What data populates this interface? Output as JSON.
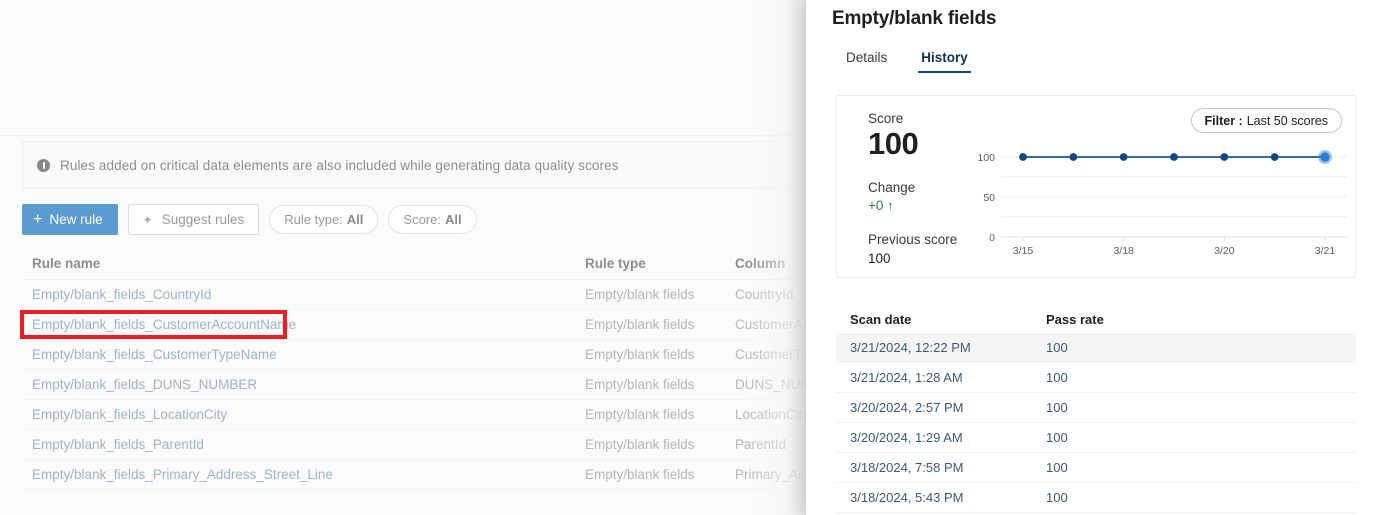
{
  "background_panel": {
    "info_banner": {
      "icon": "info-icon",
      "text": "Rules added on critical data elements are also included while generating data quality scores"
    },
    "toolbar": {
      "new_rule_label": "New rule",
      "new_rule_icon": "plus-icon",
      "suggest_rules_label": "Suggest rules",
      "suggest_rules_icon": "sparkle-icon",
      "rule_type_filter_prefix": "Rule type:",
      "rule_type_filter_value": "All",
      "score_filter_prefix": "Score:",
      "score_filter_value": "All"
    },
    "rules_table": {
      "columns": [
        "Rule name",
        "Rule type",
        "Column"
      ],
      "rows": [
        {
          "name": "Empty/blank_fields_CountryId",
          "type": "Empty/blank fields",
          "column": "CountryId",
          "highlighted": false
        },
        {
          "name": "Empty/blank_fields_CustomerAccountName",
          "type": "Empty/blank fields",
          "column": "CustomerAcc",
          "highlighted": true
        },
        {
          "name": "Empty/blank_fields_CustomerTypeName",
          "type": "Empty/blank fields",
          "column": "CustomerTyp",
          "highlighted": false
        },
        {
          "name": "Empty/blank_fields_DUNS_NUMBER",
          "type": "Empty/blank fields",
          "column": "DUNS_NUMB",
          "highlighted": false
        },
        {
          "name": "Empty/blank_fields_LocationCity",
          "type": "Empty/blank fields",
          "column": "LocationCity",
          "highlighted": false
        },
        {
          "name": "Empty/blank_fields_ParentId",
          "type": "Empty/blank fields",
          "column": "ParentId",
          "highlighted": false
        },
        {
          "name": "Empty/blank_fields_Primary_Address_Street_Line",
          "type": "Empty/blank fields",
          "column": "Primary_Add",
          "highlighted": false
        }
      ]
    },
    "highlight_color": "#ee1c25"
  },
  "flyout": {
    "title": "Empty/blank fields",
    "tabs": [
      {
        "label": "Details",
        "active": false
      },
      {
        "label": "History",
        "active": true
      }
    ],
    "score_card": {
      "score_label": "Score",
      "score_value": "100",
      "change_label": "Change",
      "change_value": "+0 ↑",
      "change_color": "#2e8540",
      "previous_label": "Previous score",
      "previous_value": "100",
      "filter_prefix": "Filter :",
      "filter_value": "Last 50 scores"
    },
    "scan_table": {
      "columns": [
        "Scan date",
        "Pass rate"
      ],
      "rows": [
        {
          "scan_date": "3/21/2024, 12:22 PM",
          "pass_rate": "100",
          "selected": true
        },
        {
          "scan_date": "3/21/2024, 1:28 AM",
          "pass_rate": "100",
          "selected": false
        },
        {
          "scan_date": "3/20/2024, 2:57 PM",
          "pass_rate": "100",
          "selected": false
        },
        {
          "scan_date": "3/20/2024, 1:29 AM",
          "pass_rate": "100",
          "selected": false
        },
        {
          "scan_date": "3/18/2024, 7:58 PM",
          "pass_rate": "100",
          "selected": false
        },
        {
          "scan_date": "3/18/2024, 5:43 PM",
          "pass_rate": "100",
          "selected": false
        }
      ]
    }
  },
  "chart_data": {
    "type": "line",
    "title": "",
    "xlabel": "",
    "ylabel": "",
    "ylim": [
      0,
      100
    ],
    "ytick_labels": [
      "100",
      "50",
      "0"
    ],
    "ytick_values": [
      100,
      50,
      0
    ],
    "gridlines": [
      100,
      75,
      50,
      25,
      0
    ],
    "xtick_labels": [
      "3/15",
      "3/18",
      "3/20",
      "3/21"
    ],
    "x": [
      "3/15",
      "3/16",
      "3/18",
      "3/19",
      "3/20",
      "3/20",
      "3/21"
    ],
    "values": [
      100,
      100,
      100,
      100,
      100,
      100,
      100
    ],
    "series": [
      {
        "name": "Score",
        "values": [
          100,
          100,
          100,
          100,
          100,
          100,
          100
        ]
      }
    ],
    "line_color": "#1a5a96",
    "marker_color": "#11487f",
    "last_marker_color": "#2b7cd3",
    "legend": "none",
    "grid": true
  }
}
